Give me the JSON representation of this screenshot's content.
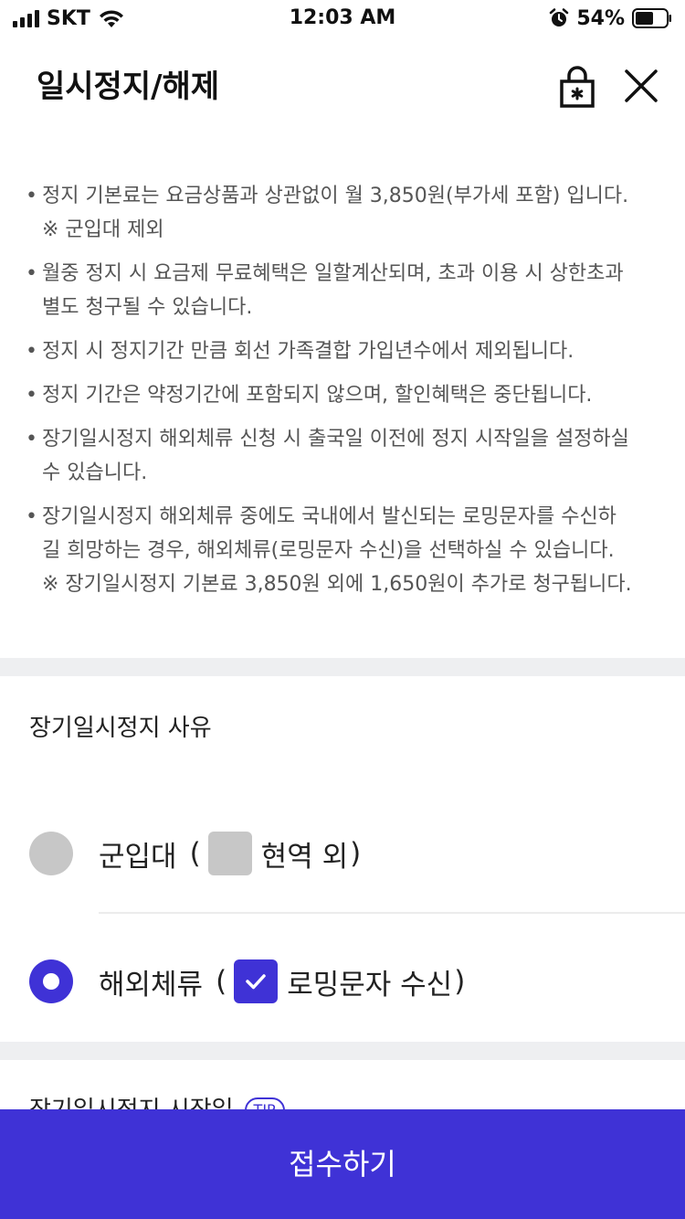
{
  "status_bar": {
    "carrier": "SKT",
    "time": "12:03 AM",
    "battery_pct": "54%",
    "icons": [
      "signal-icon",
      "wifi-icon",
      "alarm-icon",
      "battery-icon"
    ]
  },
  "header": {
    "title": "일시정지/해제",
    "lock_icon": "lock-icon",
    "close_icon": "close-icon"
  },
  "notices": [
    {
      "lines": [
        "정지 기본료는 요금상품과 상관없이 월 3,850원(부가세 포함) 입니다.",
        "※ 군입대 제외"
      ]
    },
    {
      "lines": [
        "월중 정지 시 요금제 무료혜택은 일할계산되며, 초과 이용 시 상한초과",
        "별도 청구될 수 있습니다."
      ]
    },
    {
      "lines": [
        "정지 시 정지기간 만큼 회선 가족결합 가입년수에서 제외됩니다."
      ]
    },
    {
      "lines": [
        "정지 기간은 약정기간에 포함되지 않으며, 할인혜택은 중단됩니다."
      ]
    },
    {
      "lines": [
        "장기일시정지 해외체류 신청 시 출국일 이전에 정지 시작일을 설정하실",
        "수 있습니다."
      ]
    },
    {
      "lines": [
        "장기일시정지 해외체류 중에도 국내에서 발신되는 로밍문자를 수신하",
        "길 희망하는 경우, 해외체류(로밍문자 수신)을 선택하실 수 있습니다.",
        "※ 장기일시정지 기본료 3,850원 외에 1,650원이 추가로 청구됩니다."
      ]
    }
  ],
  "bullet": "•",
  "reason_section": {
    "title": "장기일시정지 사유",
    "options": [
      {
        "label": "군입대",
        "sub_label": "현역 외",
        "selected": false,
        "checked": false
      },
      {
        "label": "해외체류",
        "sub_label": "로밍문자 수신",
        "selected": true,
        "checked": true
      }
    ],
    "paren_open": "(",
    "paren_close": ")"
  },
  "start_section": {
    "title": "장기일시정지 시작일",
    "badge": "TIP"
  },
  "submit": {
    "label": "접수하기"
  },
  "colors": {
    "accent": "#3f32d6",
    "inactive": "#c7c7c7",
    "band": "#eeeff1"
  }
}
